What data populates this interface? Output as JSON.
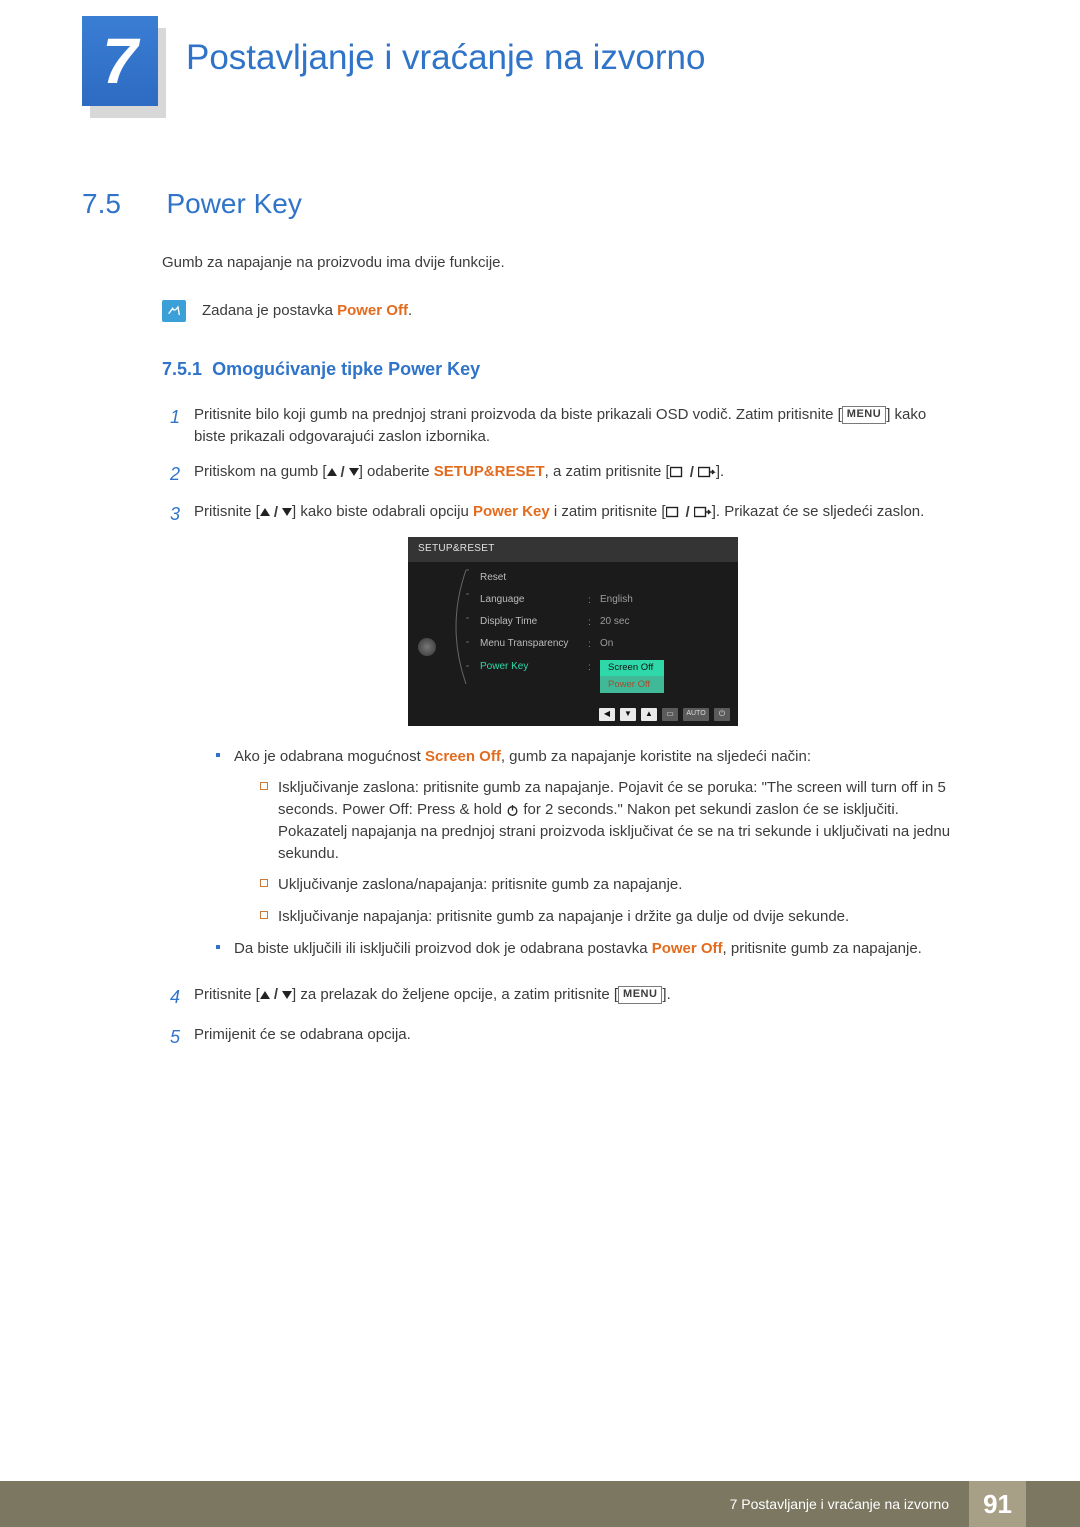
{
  "chapter": {
    "number": "7",
    "title": "Postavljanje i vraćanje na izvorno"
  },
  "section": {
    "number": "7.5",
    "title": "Power Key"
  },
  "intro": "Gumb za napajanje na proizvodu ima dvije funkcije.",
  "note": {
    "prefix": "Zadana je postavka ",
    "value": "Power Off",
    "suffix": "."
  },
  "subsection": {
    "number": "7.5.1",
    "title": "Omogućivanje tipke Power Key"
  },
  "steps": {
    "s1": {
      "num": "1",
      "text_a": "Pritisnite bilo koji gumb na prednjoj strani proizvoda da biste prikazali OSD vodič. Zatim pritisnite [",
      "menu": "MENU",
      "text_b": "] kako biste prikazali odgovarajući zaslon izbornika."
    },
    "s2": {
      "num": "2",
      "text_a": "Pritiskom na gumb [",
      "text_b": "] odaberite ",
      "hi": "SETUP&RESET",
      "text_c": ", a zatim pritisnite [",
      "text_d": "]."
    },
    "s3": {
      "num": "3",
      "text_a": "Pritisnite [",
      "text_b": "] kako biste odabrali opciju ",
      "hi": "Power Key",
      "text_c": " i zatim pritisnite [",
      "text_d": "]. Prikazat će se sljedeći zaslon."
    },
    "s4": {
      "num": "4",
      "text_a": "Pritisnite [",
      "text_b": "] za prelazak do željene opcije, a zatim pritisnite [",
      "menu": "MENU",
      "text_c": "]."
    },
    "s5": {
      "num": "5",
      "text": "Primijenit će se odabrana opcija."
    }
  },
  "osd": {
    "title": "SETUP&RESET",
    "rows": {
      "reset": {
        "label": "Reset",
        "value": ""
      },
      "language": {
        "label": "Language",
        "value": "English"
      },
      "display_time": {
        "label": "Display Time",
        "value": "20 sec"
      },
      "menu_transparency": {
        "label": "Menu Transparency",
        "value": "On"
      },
      "power_key": {
        "label": "Power Key",
        "opt1": "Screen Off",
        "opt2": "Power Off"
      }
    },
    "nav": {
      "auto": "AUTO"
    }
  },
  "bullets": {
    "b1": {
      "pre": "Ako je odabrana mogućnost ",
      "hi": "Screen Off",
      "post": ", gumb za napajanje koristite na sljedeći način:"
    },
    "b1a": {
      "pre": "Isključivanje zaslona: pritisnite gumb za napajanje. Pojavit će se poruka: \"The screen will turn off in 5 seconds. Power Off: Press & hold ",
      "post": " for 2 seconds.\" Nakon pet sekundi zaslon će se isključiti. Pokazatelj napajanja na prednjoj strani proizvoda isključivat će se na tri sekunde i uključivati na jednu sekundu."
    },
    "b1b": "Uključivanje zaslona/napajanja: pritisnite gumb za napajanje.",
    "b1c": "Isključivanje napajanja: pritisnite gumb za napajanje i držite ga dulje od dvije sekunde.",
    "b2": {
      "pre": "Da biste uključili ili isključili proizvod dok je odabrana postavka ",
      "hi": "Power Off",
      "post": ", pritisnite gumb za napajanje."
    }
  },
  "footer": {
    "text": "7 Postavljanje i vraćanje na izvorno",
    "page": "91"
  }
}
